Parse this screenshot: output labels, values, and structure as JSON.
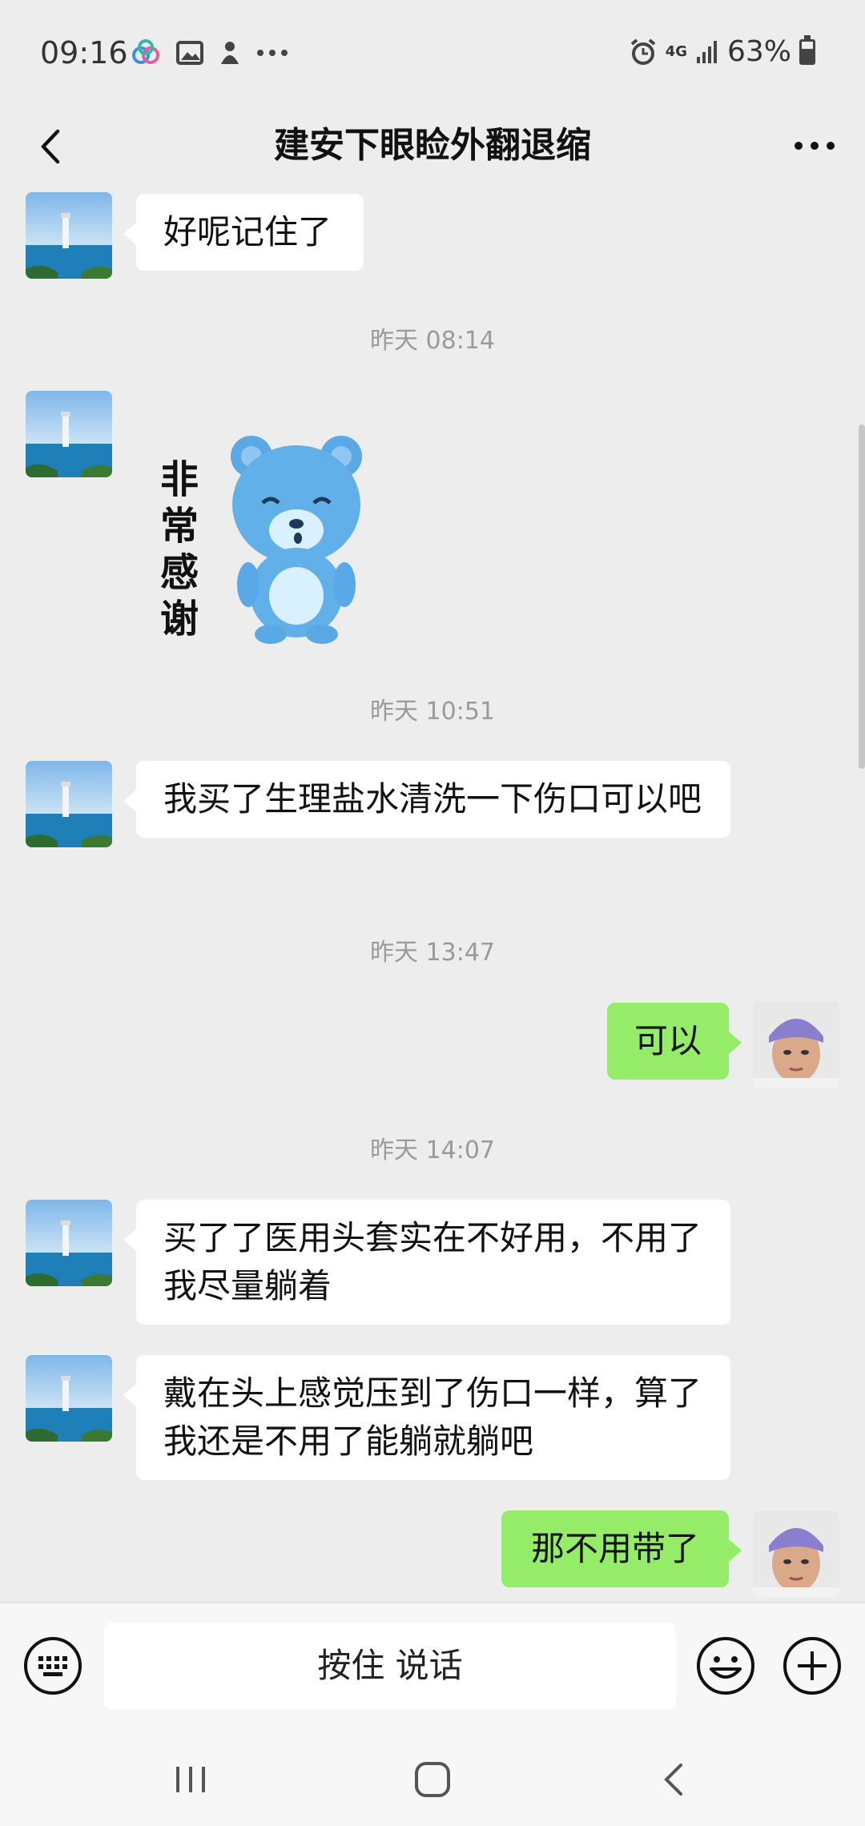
{
  "status_bar": {
    "time": "09:16",
    "left_icons": [
      "cloud-app-icon",
      "gallery-icon",
      "notification-icon",
      "more-dots-icon"
    ],
    "network": "4G",
    "battery_percent": "63%",
    "battery_level": 0.63
  },
  "header": {
    "title": "建安下眼睑外翻退缩",
    "back_icon": "chevron-left-icon",
    "more_icon": "more-horizontal-icon"
  },
  "messages": [
    {
      "side": "in",
      "type": "text",
      "text": "好呢记住了"
    },
    {
      "type": "time",
      "text": "昨天 08:14"
    },
    {
      "side": "in",
      "type": "sticker",
      "text": "非常感谢"
    },
    {
      "type": "time",
      "text": "昨天 10:51"
    },
    {
      "side": "in",
      "type": "text",
      "text": "我买了生理盐水清洗一下伤口可以吧"
    },
    {
      "type": "time",
      "text": "昨天 13:47"
    },
    {
      "side": "out",
      "type": "text",
      "text": "可以"
    },
    {
      "type": "time",
      "text": "昨天 14:07"
    },
    {
      "side": "in",
      "type": "text",
      "text": "买了了医用头套实在不好用，不用了我尽量躺着"
    },
    {
      "side": "in",
      "type": "text",
      "text": "戴在头上感觉压到了伤口一样，算了我还是不用了能躺就躺吧"
    },
    {
      "side": "out",
      "type": "text",
      "text": "那不用带了"
    }
  ],
  "input_bar": {
    "hold_to_talk": "按住 说话",
    "keyboard_icon": "keyboard-icon",
    "emoji_icon": "emoji-icon",
    "plus_icon": "plus-icon"
  },
  "system_nav": {
    "recents_icon": "recents-icon",
    "home_icon": "home-icon",
    "back_icon": "back-icon"
  },
  "colors": {
    "background": "#ededed",
    "incoming_bubble": "#ffffff",
    "outgoing_bubble": "#95ec69",
    "timestamp": "#9a9a9a"
  }
}
